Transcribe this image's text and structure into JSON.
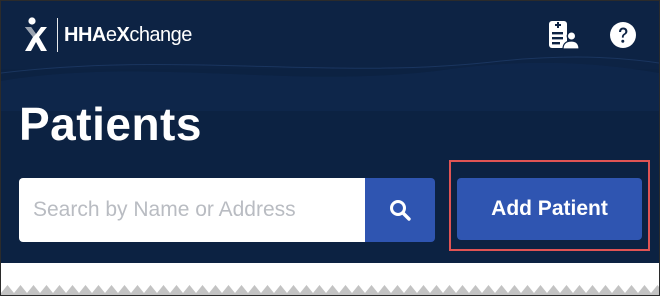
{
  "brand": {
    "name_bold_1": "HHA",
    "name_lite": "e",
    "name_bold_2": "X",
    "name_lite_2": "change",
    "logo_icon": "hhaexchange-logo-icon"
  },
  "topbar": {
    "icons": [
      "patient-list-icon",
      "help-icon"
    ]
  },
  "page": {
    "title": "Patients"
  },
  "search": {
    "placeholder": "Search by Name or Address",
    "value": "",
    "icon": "search-icon"
  },
  "actions": {
    "add_patient_label": "Add Patient"
  },
  "colors": {
    "header_bg": "#0c2242",
    "button_blue": "#2f55b1",
    "highlight_red": "#e05454"
  }
}
